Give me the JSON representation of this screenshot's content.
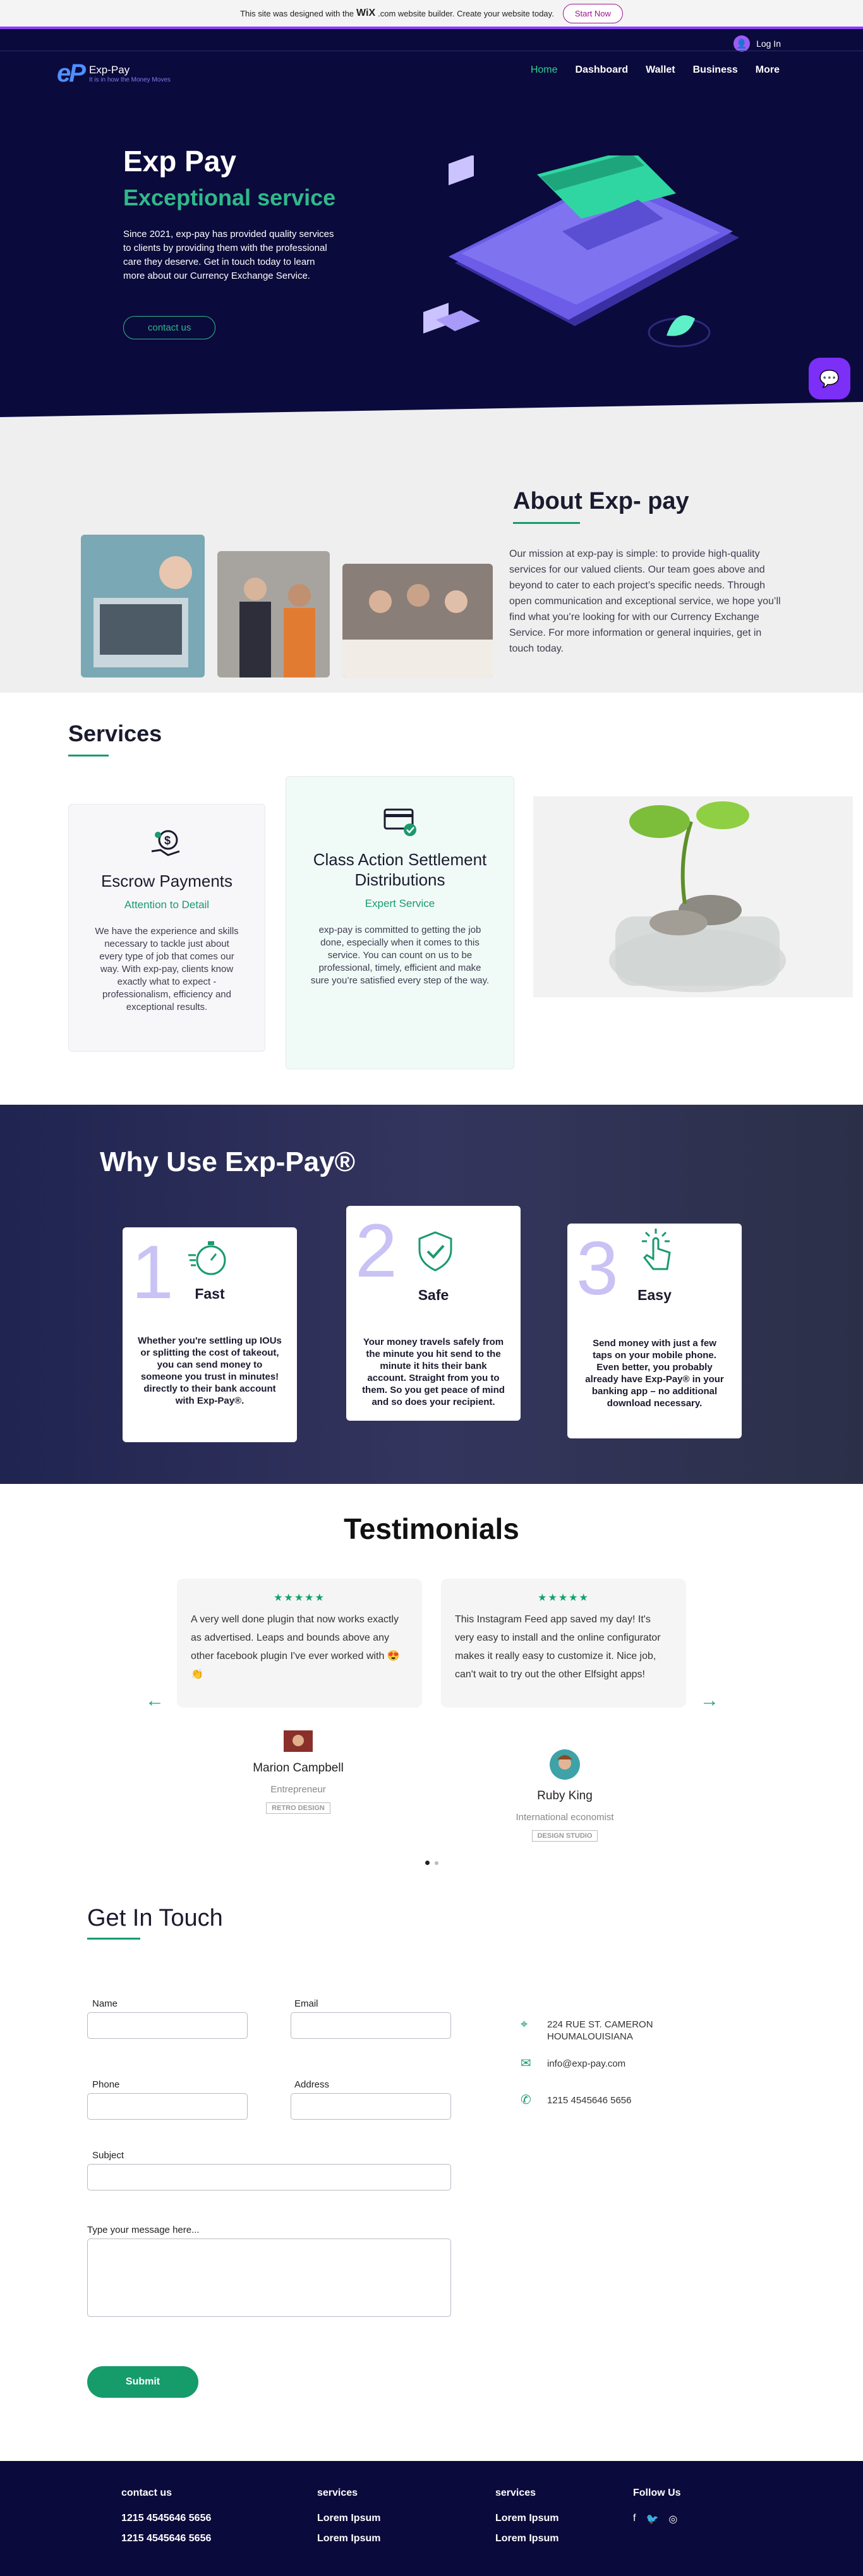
{
  "wix_banner": {
    "text_before": "This site was designed with the",
    "logo": "WiX",
    "text_after": ".com website builder. Create your website today.",
    "cta": "Start Now"
  },
  "header": {
    "login": "Log In",
    "brand_name": "Exp-Pay",
    "brand_logo": "eP",
    "brand_tagline": "It is in how the Money Moves",
    "nav": [
      "Home",
      "Dashboard",
      "Wallet",
      "Business",
      "More"
    ],
    "active_nav": "Home"
  },
  "hero": {
    "title": "Exp Pay",
    "subtitle": "Exceptional service",
    "text": "Since 2021, exp-pay has provided quality services to clients by providing them with the professional care they deserve. Get in touch today to learn more about our Currency Exchange Service.",
    "cta": "contact us",
    "chat_icon": "chat-icon"
  },
  "about": {
    "title": "About Exp- pay",
    "text": "Our mission at exp-pay is simple: to provide high-quality services for our valued clients. Our team goes above and beyond to cater to each project’s specific needs. Through open communication and exceptional service, we hope you’ll find what you’re looking for with our Currency Exchange Service. For more information or general inquiries, get in touch today."
  },
  "services": {
    "title": "Services",
    "cards": [
      {
        "title": "Escrow Payments",
        "subtitle": "Attention to Detail",
        "text": "We have the experience and skills necessary to tackle just about every type of job that comes our way. With exp-pay, clients know exactly what to expect - professionalism, efficiency and exceptional results.",
        "icon": "money-hand-icon"
      },
      {
        "title": "Class Action Settlement Distributions",
        "subtitle": "Expert Service",
        "text": "exp-pay is committed to getting the job done, especially when it comes to this service. You can count on us to be professional, timely, efficient and make sure you’re satisfied every step of the way.",
        "icon": "payment-card-icon"
      }
    ]
  },
  "why": {
    "title": "Why Use Exp-Pay®",
    "cards": [
      {
        "num": "1",
        "title": "Fast",
        "icon": "stopwatch-icon",
        "text": "Whether you're settling up IOUs or splitting the cost of takeout, you can send money to someone you trust in minutes! directly to their bank account with Exp-Pay®."
      },
      {
        "num": "2",
        "title": "Safe",
        "icon": "shield-check-icon",
        "text": "Your money travels safely from the minute you hit send to the minute it hits their bank account. Straight from you to them. So you get peace of mind and so does your recipient."
      },
      {
        "num": "3",
        "title": "Easy",
        "icon": "tap-hand-icon",
        "text": "Send money with just a few taps on your mobile phone. Even better, you probably already have Exp-Pay® in your banking app – no additional download necessary."
      }
    ]
  },
  "testimonials": {
    "title": "Testimonials",
    "stars": "★★★★★",
    "items": [
      {
        "text": "A very well done plugin that now works exactly as advertised. Leaps and bounds above any other facebook plugin I've ever worked with 😍👏",
        "name": "Marion Campbell",
        "role": "Entrepreneur",
        "logo": "RETRO DESIGN"
      },
      {
        "text": "This Instagram Feed app saved my day! It's very easy to install and the online configurator makes it really easy to customize it. Nice job, can't wait to try out the other Elfsight apps!",
        "name": "Ruby King",
        "role": "International economist",
        "logo": "DESIGN STUDIO"
      }
    ],
    "prev": "←",
    "next": "→"
  },
  "contact": {
    "title": "Get In Touch",
    "labels": {
      "name": "Name",
      "email": "Email",
      "phone": "Phone",
      "address": "Address",
      "subject": "Subject",
      "message": "Type your message here..."
    },
    "submit": "Submit",
    "info": {
      "address": "224 RUE ST. CAMERON HOUMALOUISIANA",
      "email": "info@exp-pay.com",
      "phone": "1215 4545646 5656"
    }
  },
  "footer": {
    "columns": [
      {
        "heading": "contact us",
        "items": [
          "1215 4545646 5656",
          "1215 4545646 5656"
        ]
      },
      {
        "heading": "services",
        "items": [
          "Lorem Ipsum",
          "Lorem Ipsum"
        ]
      },
      {
        "heading": "services",
        "items": [
          "Lorem Ipsum",
          "Lorem Ipsum"
        ]
      }
    ],
    "follow": "Follow Us",
    "social": [
      "f",
      "🐦",
      "◎"
    ]
  }
}
